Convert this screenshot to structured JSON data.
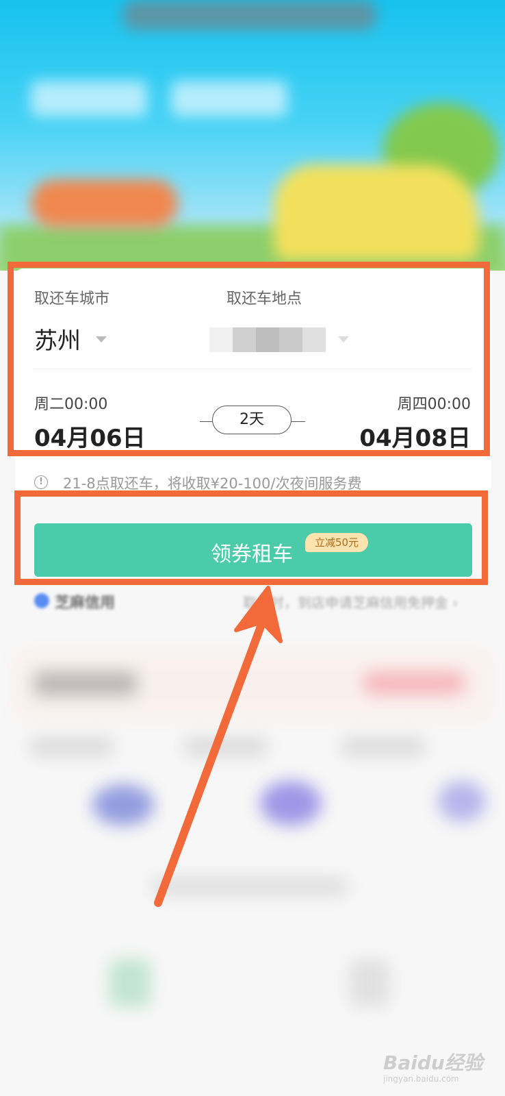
{
  "booking": {
    "city_label": "取还车城市",
    "location_label": "取还车地点",
    "city_value": "苏州",
    "pickup": {
      "weekday_time": "周二00:00",
      "date": "04月06日"
    },
    "return": {
      "weekday_time": "周四00:00",
      "date": "04月08日"
    },
    "duration": "2天"
  },
  "notice": {
    "text": "21-8点取还车，将收取¥20-100/次夜间服务费",
    "icon": "info-circle-icon",
    "icon_glyph": "!"
  },
  "rent_button": {
    "label": "领券租车",
    "coupon_badge": "立减50元"
  },
  "zhima": {
    "left_text": "芝麻信用",
    "right_text": "取车时，到店申请芝麻信用免押金",
    "chevron": "›"
  },
  "watermark": {
    "logo": "Baidu经验",
    "url": "jingyan.baidu.com"
  },
  "colors": {
    "accent_button": "#4ccbab",
    "coupon_badge_bg": "#fde3b0",
    "annotation": "#f2693a"
  }
}
